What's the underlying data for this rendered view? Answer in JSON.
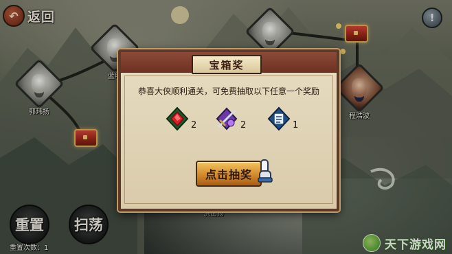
{
  "nav": {
    "back_label": "返回",
    "info_symbol": "!"
  },
  "map": {
    "nodes": [
      {
        "name": "郭玮扬"
      },
      {
        "name": "蓝明"
      },
      {
        "name": "程浩波"
      },
      {
        "name": "洪岳扬"
      }
    ]
  },
  "dialog": {
    "title": "宝箱奖",
    "message": "恭喜大侠顺利通关，可免费抽取以下任意一个奖励",
    "rewards": [
      {
        "icon": "red-gem-icon",
        "count": "2"
      },
      {
        "icon": "sword-gem-icon",
        "count": "2"
      },
      {
        "icon": "scroll-icon",
        "count": "1"
      }
    ],
    "draw_button": "点击抽奖"
  },
  "footer": {
    "reset_button": "重置",
    "sweep_button": "扫荡",
    "reset_count": "重置次数：1"
  },
  "watermark": {
    "text": "天下游戏网"
  },
  "colors": {
    "dialog_bg": "#e3d6b8",
    "title_band": "#7a3a2a",
    "draw_button": "#e0a040"
  }
}
